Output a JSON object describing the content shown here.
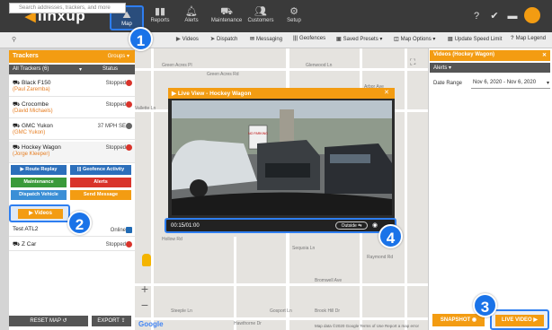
{
  "app": {
    "logo": "linxup"
  },
  "topnav": {
    "items": [
      {
        "label": "Map",
        "icon": "map-icon"
      },
      {
        "label": "Reports",
        "icon": "reports-icon"
      },
      {
        "label": "Alerts",
        "icon": "bell-icon"
      },
      {
        "label": "Maintenance",
        "icon": "car-icon"
      },
      {
        "label": "Customers",
        "icon": "users-icon"
      },
      {
        "label": "Setup",
        "icon": "gear-icon"
      }
    ]
  },
  "toolbar": {
    "search_placeholder": "Search addresses, trackers, and more",
    "videos": "Videos",
    "dispatch": "Dispatch",
    "messaging": "Messaging",
    "geofences": "Geofences",
    "saved_presets": "Saved Presets",
    "map_options": "Map Options",
    "update_speed_limit": "Update Speed Limit",
    "map_legend": "Map Legend"
  },
  "left": {
    "title": "Trackers",
    "groups": "Groups",
    "all_trackers": "All Trackers (6)",
    "status_col": "Status",
    "trackers": [
      {
        "name": "Black F150",
        "driver": "(Paul Zaremba)",
        "status": "Stopped"
      },
      {
        "name": "Crocombe",
        "driver": "(David Michaels)",
        "status": "Stopped"
      },
      {
        "name": "GMC Yukon",
        "driver": "(GMC Yukon)",
        "status": "37 MPH SE"
      },
      {
        "name": "Hockey Wagon",
        "driver": "(Jorge Kleeper)",
        "status": "Stopped"
      },
      {
        "name": "Test ATL2",
        "driver": "",
        "status": "Online"
      },
      {
        "name": "Z Car",
        "driver": "",
        "status": "Stopped"
      }
    ],
    "actions": {
      "route_replay": "Route Replay",
      "geofence_activity": "Geofence Activity",
      "maintenance": "Maintenance",
      "alerts": "Alerts",
      "dispatch_vehicle": "Dispatch Vehicle",
      "send_message": "Send Message",
      "videos": "Videos"
    },
    "reset_map": "RESET MAP",
    "export": "EXPORT"
  },
  "map": {
    "streets": [
      "Green Acres Rd",
      "Green Acres Pl",
      "Glenwood Ln",
      "Vallette Ln",
      "Bromwell Ave",
      "Arbor Ave",
      "Hollow Rd",
      "Steeple Ln",
      "Gosport Ln",
      "Sequoia Ln",
      "Raymond Rd",
      "Brook Hill Dr",
      "Hawthorne Dr"
    ],
    "credit": "Map data ©2020 Google  Terms of Use  Report a map error",
    "google": "Google"
  },
  "video": {
    "title": "Live View - Hockey Wagon",
    "time": "00:15/01:00",
    "camera": "Outside",
    "sign": "NO PARKING"
  },
  "right": {
    "title": "Videos (Hockey Wagon)",
    "tab": "Alerts",
    "date_label": "Date Range",
    "date_value": "Nov 6, 2020 - Nov 6, 2020",
    "snapshot": "SNAPSHOT",
    "live_video": "LIVE VIDEO"
  },
  "badges": [
    "1",
    "2",
    "3",
    "4"
  ],
  "colors": {
    "accent": "#f39c12",
    "highlight": "#2e7ef0",
    "badge": "#1a73e8",
    "nav": "#3a3a3a"
  }
}
